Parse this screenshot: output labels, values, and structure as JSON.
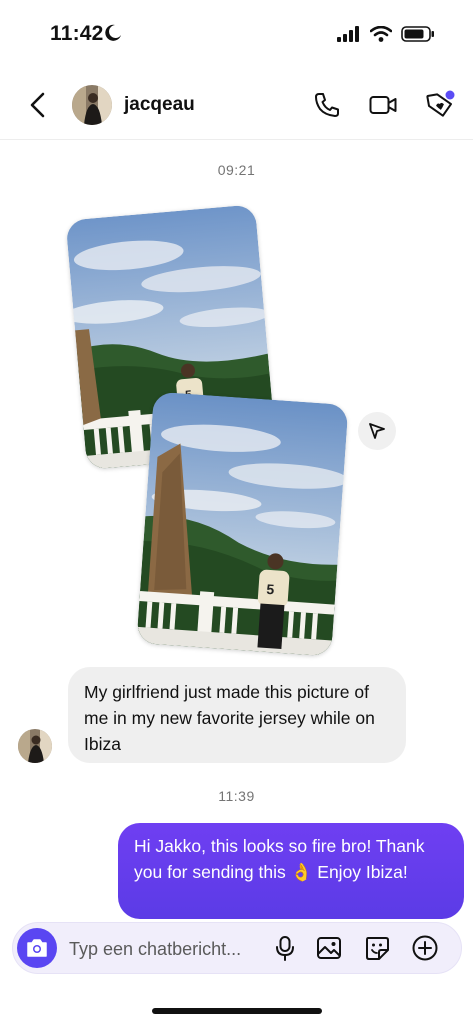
{
  "status_bar": {
    "time": "11:42"
  },
  "header": {
    "username": "jacqeau",
    "icons": [
      "back-icon",
      "phone-icon",
      "video-camera-icon",
      "tag-icon"
    ],
    "accent_dot_color": "#5b4cf5"
  },
  "chat": {
    "timestamp_1": "09:21",
    "incoming_message": "My girlfriend just made this picture of me in my new favorite jersey while on Ibiza",
    "timestamp_2": "11:39",
    "outgoing_message": "Hi Jakko, this looks so fire bro! Thank you for sending this 👌 Enjoy Ibiza!",
    "jersey_number": "5"
  },
  "composer": {
    "placeholder": "Typ een chatbericht...",
    "icons": [
      "camera-icon",
      "microphone-icon",
      "image-icon",
      "sticker-icon",
      "plus-icon"
    ],
    "accent_color": "#5a46f2"
  },
  "colors": {
    "outgoing_bubble": "#6240ee",
    "incoming_bubble": "#efefef"
  }
}
